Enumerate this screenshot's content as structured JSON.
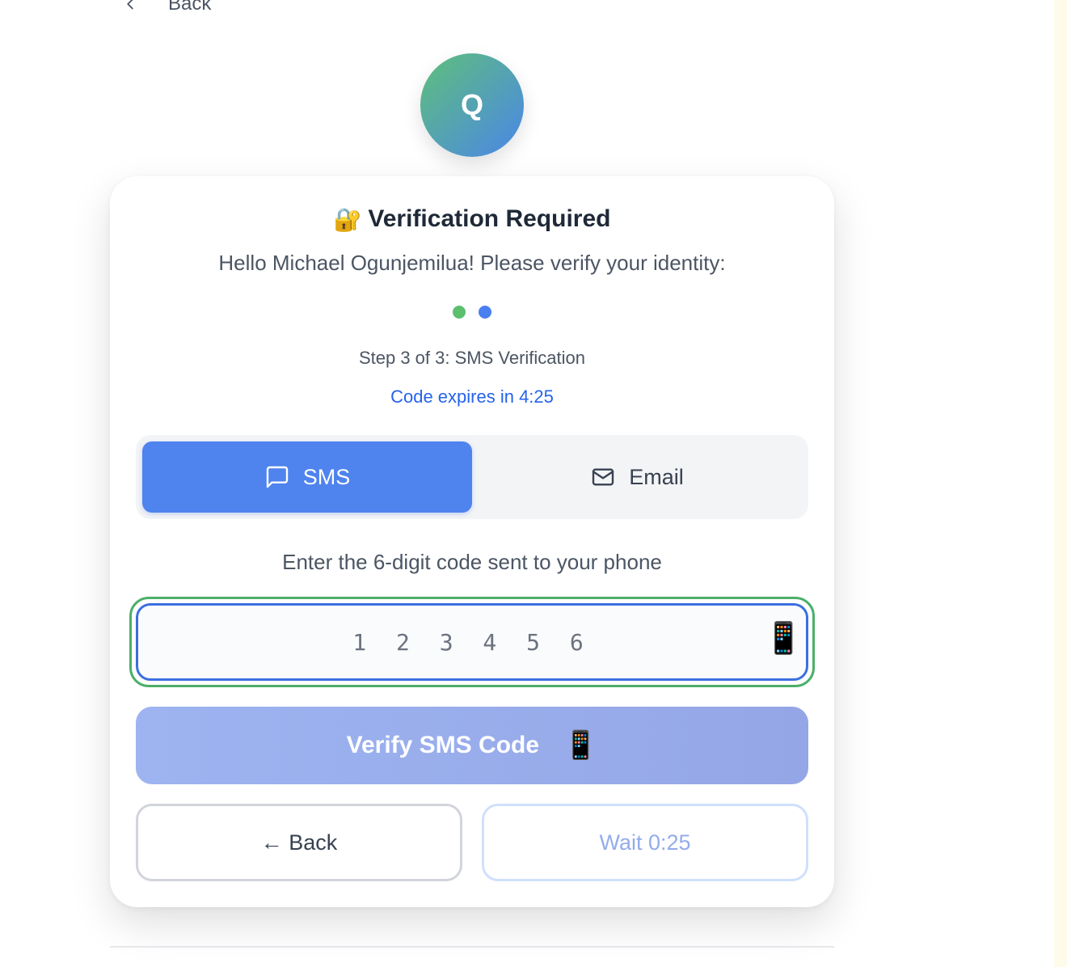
{
  "nav": {
    "back_label": "Back"
  },
  "avatar": {
    "initial": "Q"
  },
  "card": {
    "title_icon": "🔐",
    "title": "Verification Required",
    "greeting": "Hello Michael Ogunjemilua! Please verify your identity:",
    "progress_dots": [
      {
        "color": "#5cbf6d",
        "state": "completed"
      },
      {
        "color": "#4a7ff0",
        "state": "active"
      }
    ],
    "step_text": "Step 3 of 3: SMS Verification",
    "expires_text": "Code expires in 4:25",
    "tabs": [
      {
        "label": "SMS",
        "icon": "message-icon",
        "active": true
      },
      {
        "label": "Email",
        "icon": "mail-icon",
        "active": false
      }
    ],
    "instruction": "Enter the 6-digit code sent to your phone",
    "code_field": {
      "value": "",
      "placeholder": "123456",
      "icon": "📱"
    },
    "verify_button": {
      "label": "Verify SMS Code",
      "icon": "📱"
    },
    "back_button": {
      "label": "← Back"
    },
    "resend_button": {
      "label": "Wait 0:25"
    }
  },
  "colors": {
    "accent": "#4f83ee",
    "success": "#4caf6a",
    "link": "#2563eb"
  }
}
